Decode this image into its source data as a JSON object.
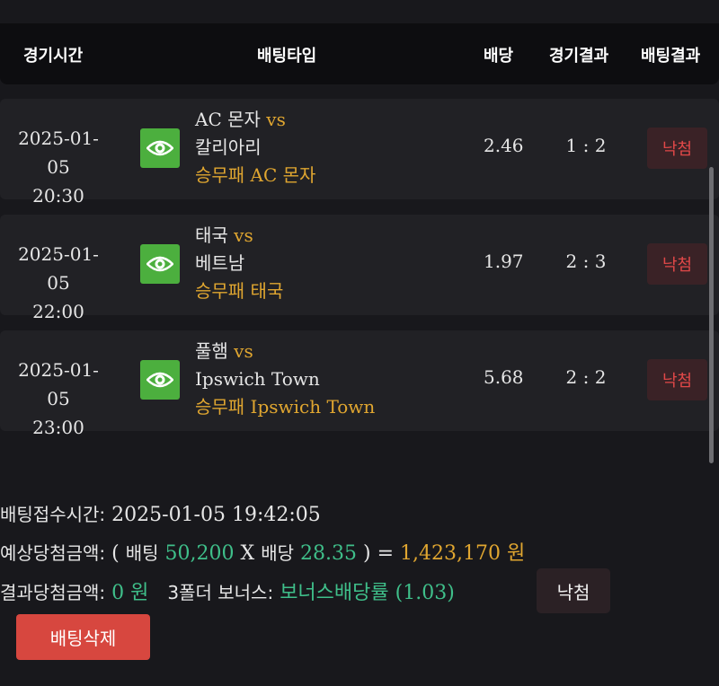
{
  "header": {
    "time": "경기시간",
    "type": "배팅타입",
    "odds": "배당",
    "result": "경기결과",
    "bet_result": "배팅결과"
  },
  "bets": [
    {
      "date": "2025-01-05",
      "time": "20:30",
      "home": "AC 몬자",
      "vs": "vs",
      "away": "칼리아리",
      "pick": "승무패 AC 몬자",
      "odds": "2.46",
      "score": "1 : 2",
      "status": "낙첨"
    },
    {
      "date": "2025-01-05",
      "time": "22:00",
      "home": "태국",
      "vs": "vs",
      "away": "베트남",
      "pick": "승무패 태국",
      "odds": "1.97",
      "score": "2 : 3",
      "status": "낙첨"
    },
    {
      "date": "2025-01-05",
      "time": "23:00",
      "home": "풀햄",
      "vs": "vs",
      "away": "Ipswich Town",
      "pick": "승무패 Ipswich Town",
      "odds": "5.68",
      "score": "2 : 2",
      "status": "낙첨"
    }
  ],
  "summary": {
    "receipt_label": "배팅접수시간:",
    "receipt_time": "2025-01-05 19:42:05",
    "expected_label": "예상당첨금액:",
    "open_paren": "(",
    "bet_word": "배팅",
    "bet_amount": "50,200",
    "times": "X",
    "odds_word": "배당",
    "total_odds": "28.35",
    "close_eq": ") =",
    "expected_amount": "1,423,170 원",
    "result_label": "결과당첨금액:",
    "result_amount": "0 원",
    "bonus_label": "3폴더 보너스:",
    "bonus_value": "보너스배당률 (1.03)",
    "status": "낙첨"
  },
  "delete_button": "배팅삭제",
  "icons": {
    "view": "eye-icon"
  },
  "colors": {
    "accent_gold": "#e0a630",
    "accent_green": "#3fbf8a",
    "icon_green": "#4caf3e",
    "danger": "#d7473f"
  }
}
